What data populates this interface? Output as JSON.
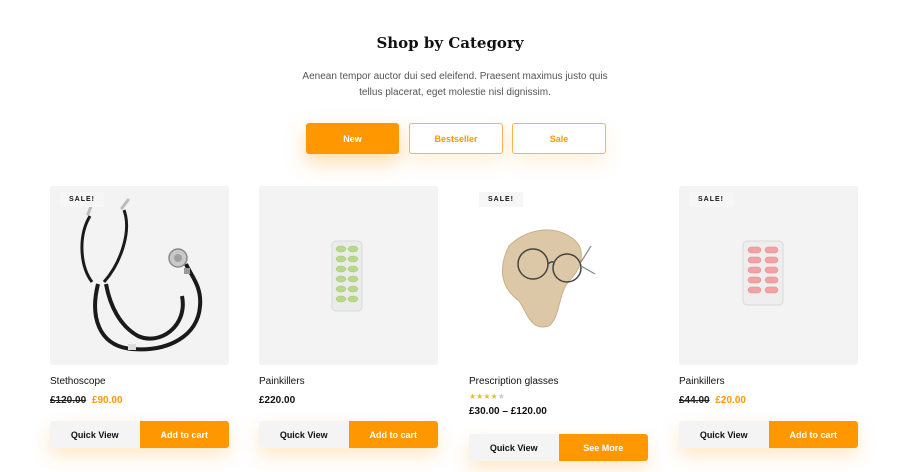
{
  "section": {
    "title": "Shop by Category",
    "subtitle": "Aenean tempor auctor dui sed eleifend. Praesent maximus justo quis tellus placerat, eget molestie nisl dignissim."
  },
  "tabs": [
    {
      "label": "New",
      "active": true
    },
    {
      "label": "Bestseller",
      "active": false
    },
    {
      "label": "Sale",
      "active": false
    }
  ],
  "products": [
    {
      "badge": "SALE!",
      "title": "Stethoscope",
      "old_price": "£120.00",
      "price": "£90.00",
      "image_icon": "stethoscope-icon",
      "quick_view_label": "Quick View",
      "action_label": "Add to cart"
    },
    {
      "title": "Painkillers",
      "price": "£220.00",
      "image_icon": "pill-blister-icon",
      "quick_view_label": "Quick View",
      "action_label": "Add to cart"
    },
    {
      "badge": "SALE!",
      "title": "Prescription glasses",
      "rating": 3.5,
      "rating_max": 5,
      "price_range": "£30.00 – £120.00",
      "image_icon": "glasses-icon",
      "quick_view_label": "Quick View",
      "action_label": "See More"
    },
    {
      "badge": "SALE!",
      "title": "Painkillers",
      "old_price": "£44.00",
      "price": "£20.00",
      "image_icon": "capsule-blister-icon",
      "quick_view_label": "Quick View",
      "action_label": "Add to cart"
    }
  ],
  "colors": {
    "accent": "#ff9800",
    "star": "#e4bc3c"
  }
}
